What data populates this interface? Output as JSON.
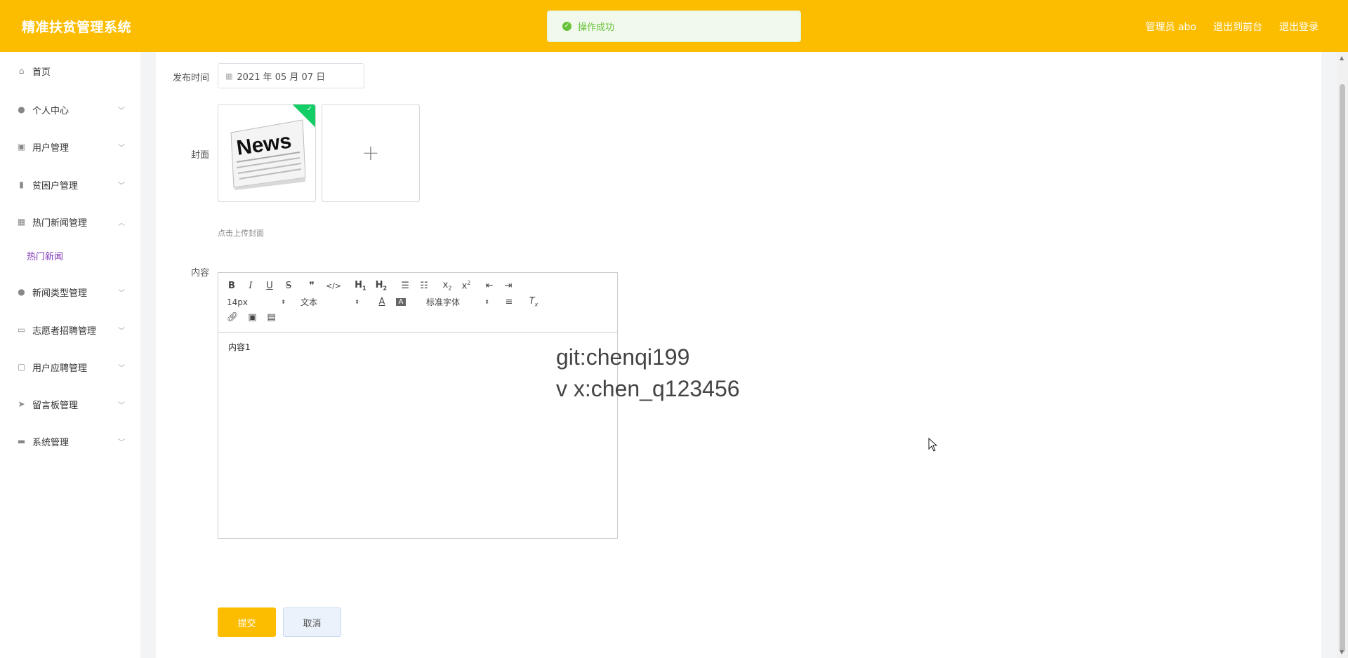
{
  "header": {
    "app_title": "精准扶贫管理系统",
    "user_label": "管理员 abo",
    "exit_frontend": "退出到前台",
    "logout": "退出登录"
  },
  "toast": {
    "message": "操作成功"
  },
  "sidebar": {
    "items": [
      {
        "label": "首页",
        "icon": "home-icon"
      },
      {
        "label": "个人中心",
        "icon": "user-icon"
      },
      {
        "label": "用户管理",
        "icon": "chart-check-icon"
      },
      {
        "label": "贫困户管理",
        "icon": "bar-chart-icon"
      },
      {
        "label": "热门新闻管理",
        "icon": "grid-icon"
      },
      {
        "label": "新闻类型管理",
        "icon": "person-icon"
      },
      {
        "label": "志愿者招聘管理",
        "icon": "id-card-icon"
      },
      {
        "label": "用户应聘管理",
        "icon": "message-icon"
      },
      {
        "label": "留言板管理",
        "icon": "send-icon"
      },
      {
        "label": "系统管理",
        "icon": "briefcase-icon"
      }
    ],
    "sub_item": "热门新闻"
  },
  "form": {
    "publish_time_label": "发布时间",
    "publish_time_value": "2021 年 05 月 07 日",
    "cover_label": "封面",
    "cover_image_text": "News",
    "upload_tip": "点击上传封面",
    "content_label": "内容",
    "content_text": "内容1"
  },
  "editor": {
    "font_size": "14px",
    "format": "文本",
    "font_family": "标准字体"
  },
  "watermark": {
    "line1": "git:chenqi199",
    "line2": "v x:chen_q123456"
  },
  "buttons": {
    "submit": "提交",
    "cancel": "取消"
  },
  "colors": {
    "brand": "#fcbd00",
    "success": "#67c23a",
    "active_sub": "#7b2fb5"
  }
}
